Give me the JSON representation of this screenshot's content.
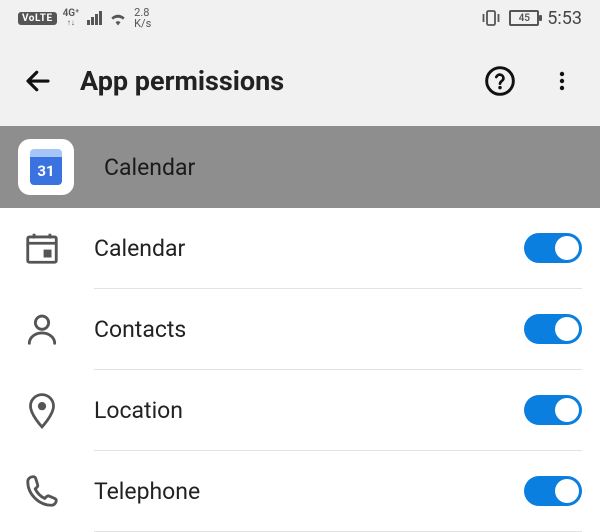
{
  "status": {
    "volte": "VoLTE",
    "netType": "4G⁺",
    "speedTop": "2.8",
    "speedBottom": "K/s",
    "battery": "45",
    "time": "5:53"
  },
  "header": {
    "title": "App permissions"
  },
  "app": {
    "name": "Calendar",
    "iconDay": "31"
  },
  "permissions": [
    {
      "key": "calendar",
      "label": "Calendar",
      "enabled": true
    },
    {
      "key": "contacts",
      "label": "Contacts",
      "enabled": true
    },
    {
      "key": "location",
      "label": "Location",
      "enabled": true
    },
    {
      "key": "telephone",
      "label": "Telephone",
      "enabled": true
    }
  ]
}
